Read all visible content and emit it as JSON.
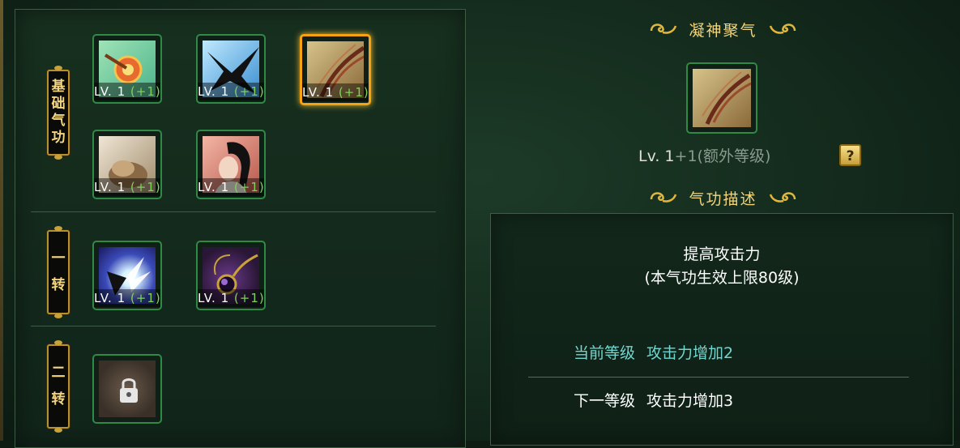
{
  "sections": {
    "basic": {
      "label_chars": [
        "基",
        "础",
        "气",
        "功"
      ]
    },
    "first": {
      "label_chars": [
        "一",
        "转"
      ]
    },
    "second": {
      "label_chars": [
        "二",
        "转"
      ]
    }
  },
  "skills": [
    {
      "icon": "target-arrow-icon",
      "lv": "LV. 1",
      "bonus": "(+1)"
    },
    {
      "icon": "black-bird-icon",
      "lv": "LV. 1",
      "bonus": "(+1)"
    },
    {
      "icon": "feathered-bow-icon",
      "lv": "LV. 1",
      "bonus": "(+1)",
      "selected": true
    },
    {
      "icon": "stone-fist-icon",
      "lv": "LV. 1",
      "bonus": "(+1)"
    },
    {
      "icon": "warrior-portrait-icon",
      "lv": "LV. 1",
      "bonus": "(+1)"
    },
    {
      "icon": "lightning-burst-icon",
      "lv": "LV. 1",
      "bonus": "(+1)"
    },
    {
      "icon": "purple-orb-amulet-icon",
      "lv": "LV. 1",
      "bonus": "(+1)"
    },
    {
      "icon": "lock-icon",
      "locked": true
    }
  ],
  "detail": {
    "skill_title": "凝神聚气",
    "level_main": "Lv. 1",
    "level_plus": "+1",
    "level_extra": "(额外等级)",
    "help_label": "?",
    "desc_title": "气功描述",
    "desc_line1": "提高攻击力",
    "desc_line2": "(本气功生效上限80级)",
    "current_label": "当前等级",
    "current_effect": "攻击力增加2",
    "next_label": "下一等级",
    "next_effect": "攻击力增加3"
  },
  "colors": {
    "accent_gold": "#f4d57c",
    "slot_border": "#2f8a45",
    "selected_border": "#f5a315",
    "bonus_green": "#7dd35a",
    "current_teal": "#6fd7cf"
  }
}
